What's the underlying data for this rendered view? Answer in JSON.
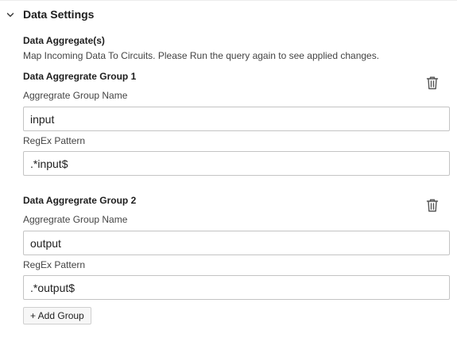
{
  "section": {
    "title": "Data Settings",
    "expanded": true
  },
  "aggregates": {
    "heading": "Data Aggregate(s)",
    "description": "Map Incoming Data To Circuits. Please Run the query again to see applied changes."
  },
  "groups": [
    {
      "title": "Data Aggregrate Group 1",
      "name_label": "Aggregrate Group Name",
      "name_value": "input",
      "pattern_label": "RegEx Pattern",
      "pattern_value": ".*input$"
    },
    {
      "title": "Data Aggregrate Group 2",
      "name_label": "Aggregrate Group Name",
      "name_value": "output",
      "pattern_label": "RegEx Pattern",
      "pattern_value": ".*output$"
    }
  ],
  "add_button_label": "+ Add Group",
  "icons": {
    "collapse": "chevron-down-icon",
    "delete": "trash-icon"
  },
  "colors": {
    "border": "#c4c4c4",
    "text": "#1f1f1f",
    "muted_text": "#444444"
  }
}
